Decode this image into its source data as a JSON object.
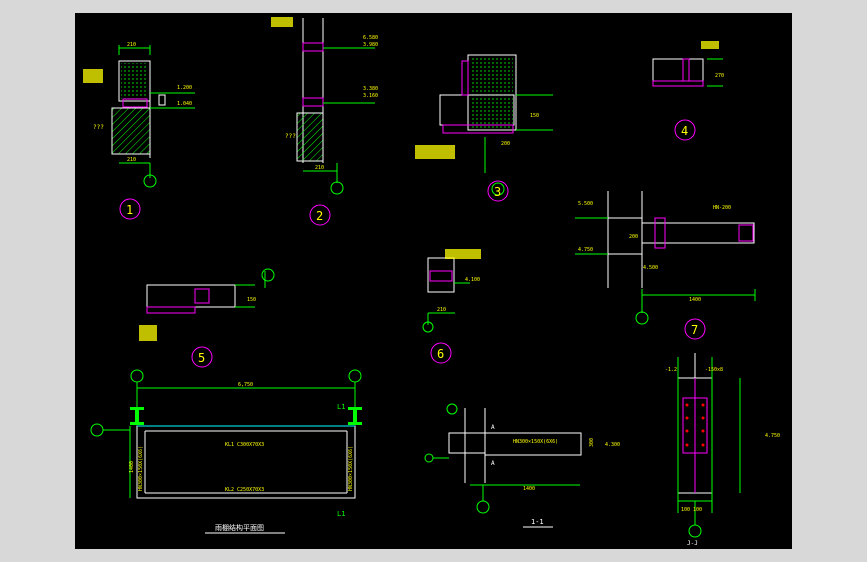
{
  "drawing": {
    "background": "#000000",
    "outer_background": "#d8d8d8",
    "colors": {
      "line_green": "#00ff00",
      "line_white": "#ffffff",
      "text_yellow": "#ffff00",
      "magenta": "#ff00ff",
      "cyan": "#00ffff",
      "red": "#ff0000"
    }
  },
  "details": [
    {
      "id": "1"
    },
    {
      "id": "2"
    },
    {
      "id": "3"
    },
    {
      "id": "4"
    },
    {
      "id": "5"
    },
    {
      "id": "6"
    },
    {
      "id": "7"
    }
  ],
  "labels": {
    "d1_top": "210",
    "d1_bottom": "210",
    "d1_elev1": "1.200",
    "d1_elev2": "1.040",
    "d1_q": "???",
    "d2_elev1": "6.580",
    "d2_elev2": "3.980",
    "d2_elev3": "3.380",
    "d2_elev4": "3.160",
    "d2_q": "???",
    "d2_bottom": "210",
    "d3_dim1": "200",
    "d3_dim2": "150",
    "d4_dim": "270",
    "d5_dim": "150",
    "d6_elev": "4.100",
    "d6_dim": "210",
    "d7_elev1": "5.500",
    "d7_elev2": "4.750",
    "d7_elev3": "4.500",
    "d7_elev4": "4.750",
    "d7_span": "1400",
    "d7_hn": "HN-200",
    "d7_h": "200",
    "plan_span": "6,750",
    "plan_depth": "1400",
    "plan_beam1": "KL1 C300X70X3",
    "plan_beam2": "KL2 C250X70X3",
    "plan_l1": "L1",
    "plan_l1b": "L1",
    "plan_hn": "HN300×150X(6X6)",
    "plan_title": "雨棚结构平面图",
    "sec_beam": "HN300×150X(6X6)",
    "sec_elev": "4.300",
    "sec_span": "1400",
    "sec_a1": "A",
    "sec_a2": "A",
    "sec_title": "1-1",
    "sec_h": "300",
    "col_elev": "4.750",
    "col_top": "-1.2",
    "col_rib": "-150x8",
    "col_dims": "100 100",
    "col_title": "J-J"
  }
}
